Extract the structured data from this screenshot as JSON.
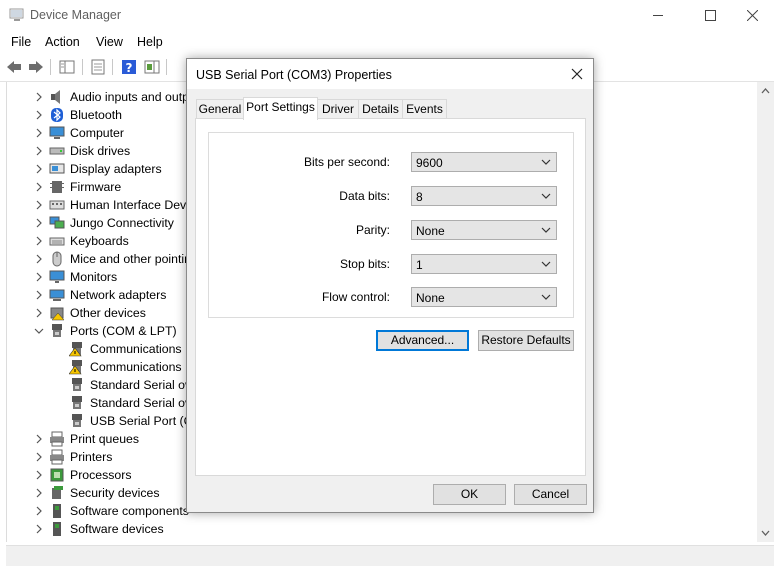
{
  "window": {
    "title": "Device Manager"
  },
  "menu": [
    "File",
    "Action",
    "View",
    "Help"
  ],
  "tree": [
    {
      "label": "Audio inputs and outp",
      "icon": "speaker-icon",
      "expanded": false
    },
    {
      "label": "Bluetooth",
      "icon": "bluetooth-icon",
      "expanded": false
    },
    {
      "label": "Computer",
      "icon": "computer-icon",
      "expanded": false
    },
    {
      "label": "Disk drives",
      "icon": "disk-drive-icon",
      "expanded": false
    },
    {
      "label": "Display adapters",
      "icon": "display-adapter-icon",
      "expanded": false
    },
    {
      "label": "Firmware",
      "icon": "firmware-icon",
      "expanded": false
    },
    {
      "label": "Human Interface Devic",
      "icon": "hid-icon",
      "expanded": false
    },
    {
      "label": "Jungo Connectivity",
      "icon": "network-icon",
      "expanded": false
    },
    {
      "label": "Keyboards",
      "icon": "keyboard-icon",
      "expanded": false
    },
    {
      "label": "Mice and other pointin",
      "icon": "mouse-icon",
      "expanded": false
    },
    {
      "label": "Monitors",
      "icon": "monitor-icon",
      "expanded": false
    },
    {
      "label": "Network adapters",
      "icon": "network-adapter-icon",
      "expanded": false
    },
    {
      "label": "Other devices",
      "icon": "unknown-device-icon",
      "expanded": false
    },
    {
      "label": "Ports (COM & LPT)",
      "icon": "port-icon",
      "expanded": true
    },
    {
      "label": "Communications P",
      "icon": "port-warning-icon",
      "child": true
    },
    {
      "label": "Communications P",
      "icon": "port-warning-icon",
      "child": true
    },
    {
      "label": "Standard Serial ove",
      "icon": "port-icon",
      "child": true
    },
    {
      "label": "Standard Serial ove",
      "icon": "port-icon",
      "child": true
    },
    {
      "label": "USB Serial Port (CO",
      "icon": "port-icon",
      "child": true
    },
    {
      "label": "Print queues",
      "icon": "printer-icon",
      "expanded": false
    },
    {
      "label": "Printers",
      "icon": "printer-icon",
      "expanded": false
    },
    {
      "label": "Processors",
      "icon": "processor-icon",
      "expanded": false
    },
    {
      "label": "Security devices",
      "icon": "security-icon",
      "expanded": false
    },
    {
      "label": "Software components",
      "icon": "software-icon",
      "expanded": false
    },
    {
      "label": "Software devices",
      "icon": "software-icon",
      "expanded": false
    }
  ],
  "dialog": {
    "title": "USB Serial Port (COM3) Properties",
    "tabs": [
      "General",
      "Port Settings",
      "Driver",
      "Details",
      "Events"
    ],
    "active_tab": "Port Settings",
    "fields": [
      {
        "label": "Bits per second:",
        "value": "9600"
      },
      {
        "label": "Data bits:",
        "value": "8"
      },
      {
        "label": "Parity:",
        "value": "None"
      },
      {
        "label": "Stop bits:",
        "value": "1"
      },
      {
        "label": "Flow control:",
        "value": "None"
      }
    ],
    "advanced_label": "Advanced...",
    "restore_label": "Restore Defaults",
    "ok_label": "OK",
    "cancel_label": "Cancel"
  },
  "colors": {
    "accent": "#0078d7",
    "dialog_bg": "#f0f0f0"
  }
}
